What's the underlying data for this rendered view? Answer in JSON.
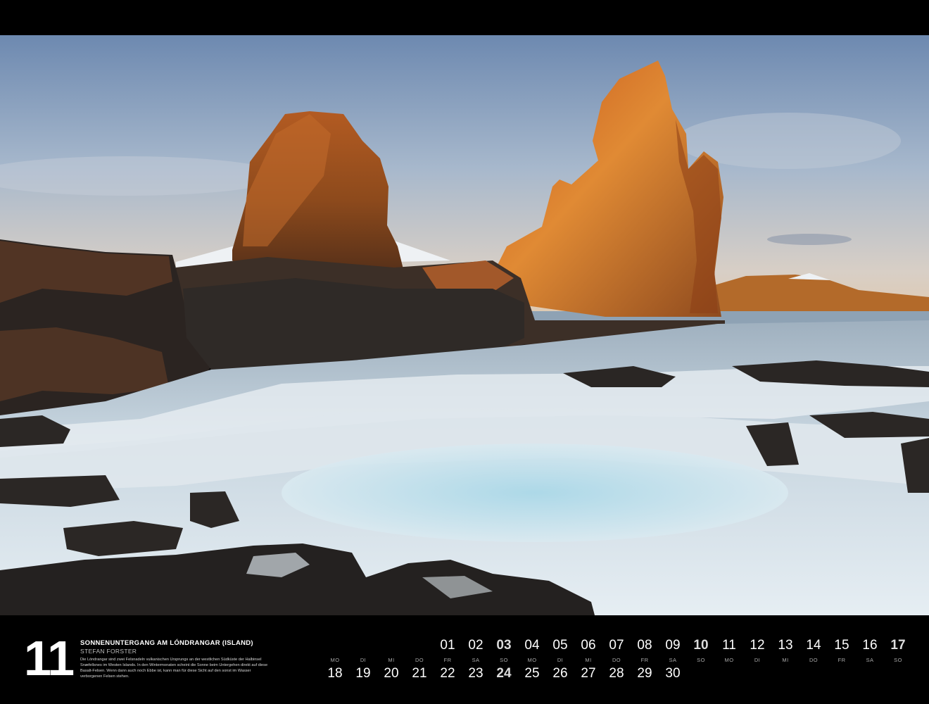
{
  "month_number": "11",
  "caption": {
    "title": "SONNENUNTERGANG AM LÓNDRANGAR (ISLAND)",
    "author": "STEFAN FORSTER",
    "description": "Die Lóndrangar sind zwei Felsnadeln vulkanischen Ursprungs an der westlichen Südküste der Halbinsel Snæfellsnes im Westen Islands. In den Wintermonaten scheint die Sonne beim Untergehen direkt auf diese Basalt-Felsen. Wenn dann auch noch Ebbe ist, kann man für diese Sicht auf den sonst im Wasser verborgenen Felsen stehen."
  },
  "calendar": {
    "top_row": [
      {
        "day": "01",
        "weekday": "FR",
        "sunday": false
      },
      {
        "day": "02",
        "weekday": "SA",
        "sunday": false
      },
      {
        "day": "03",
        "weekday": "SO",
        "sunday": true
      },
      {
        "day": "04",
        "weekday": "MO",
        "sunday": false
      },
      {
        "day": "05",
        "weekday": "DI",
        "sunday": false
      },
      {
        "day": "06",
        "weekday": "MI",
        "sunday": false
      },
      {
        "day": "07",
        "weekday": "DO",
        "sunday": false
      },
      {
        "day": "08",
        "weekday": "FR",
        "sunday": false
      },
      {
        "day": "09",
        "weekday": "SA",
        "sunday": false
      },
      {
        "day": "10",
        "weekday": "SO",
        "sunday": true
      },
      {
        "day": "11",
        "weekday": "MO",
        "sunday": false
      },
      {
        "day": "12",
        "weekday": "DI",
        "sunday": false
      },
      {
        "day": "13",
        "weekday": "MI",
        "sunday": false
      },
      {
        "day": "14",
        "weekday": "DO",
        "sunday": false
      },
      {
        "day": "15",
        "weekday": "FR",
        "sunday": false
      },
      {
        "day": "16",
        "weekday": "SA",
        "sunday": false
      },
      {
        "day": "17",
        "weekday": "SO",
        "sunday": true
      }
    ],
    "bottom_row": [
      {
        "day": "18",
        "weekday": "MO",
        "sunday": false
      },
      {
        "day": "19",
        "weekday": "DI",
        "sunday": false
      },
      {
        "day": "20",
        "weekday": "MI",
        "sunday": false
      },
      {
        "day": "21",
        "weekday": "DO",
        "sunday": false
      },
      {
        "day": "22",
        "weekday": "FR",
        "sunday": false
      },
      {
        "day": "23",
        "weekday": "SA",
        "sunday": false
      },
      {
        "day": "24",
        "weekday": "SO",
        "sunday": true
      },
      {
        "day": "25",
        "weekday": "MO",
        "sunday": false
      },
      {
        "day": "26",
        "weekday": "DI",
        "sunday": false
      },
      {
        "day": "27",
        "weekday": "MI",
        "sunday": false
      },
      {
        "day": "28",
        "weekday": "DO",
        "sunday": false
      },
      {
        "day": "29",
        "weekday": "FR",
        "sunday": false
      },
      {
        "day": "30",
        "weekday": "SA",
        "sunday": false
      }
    ]
  },
  "colors": {
    "background": "#000000",
    "sky_top": "#6f8bb0",
    "sky_bottom": "#d9cfc4",
    "rock_lit": "#d7782a",
    "rock_dark": "#2a2320",
    "water": "#cfe3ee"
  }
}
